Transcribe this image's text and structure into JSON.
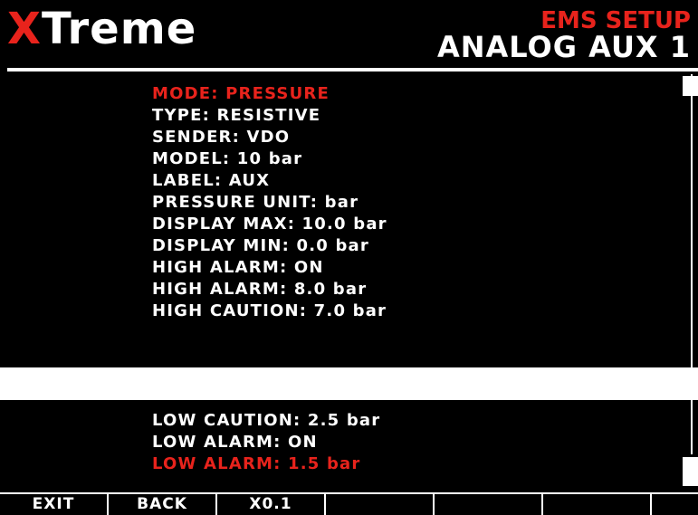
{
  "header": {
    "logo_x": "X",
    "logo_rest": "Treme",
    "title": "EMS SETUP",
    "subtitle": "ANALOG AUX 1"
  },
  "menu_top": [
    {
      "label": "MODE: PRESSURE",
      "selected": true
    },
    {
      "label": "TYPE: RESISTIVE"
    },
    {
      "label": "SENDER: VDO"
    },
    {
      "label": "MODEL: 10 bar"
    },
    {
      "label": "LABEL: AUX"
    },
    {
      "label": "PRESSURE UNIT: bar"
    },
    {
      "label": "DISPLAY MAX: 10.0 bar"
    },
    {
      "label": "DISPLAY MIN: 0.0 bar"
    },
    {
      "label": "HIGH ALARM: ON"
    },
    {
      "label": "HIGH ALARM: 8.0 bar"
    },
    {
      "label": "HIGH CAUTION: 7.0 bar"
    }
  ],
  "menu_bottom": [
    {
      "label": "LOW CAUTION: 2.5 bar"
    },
    {
      "label": "LOW ALARM: ON"
    },
    {
      "label": "LOW ALARM: 1.5 bar",
      "selected": true
    }
  ],
  "softkeys": [
    {
      "label": "EXIT"
    },
    {
      "label": "BACK"
    },
    {
      "label": "X0.1"
    },
    {
      "label": ""
    },
    {
      "label": ""
    },
    {
      "label": ""
    },
    {
      "label": "",
      "icon": "rotary-knob-icon"
    }
  ],
  "colors": {
    "background": "#000000",
    "text": "#ffffff",
    "accent": "#e8231c"
  }
}
